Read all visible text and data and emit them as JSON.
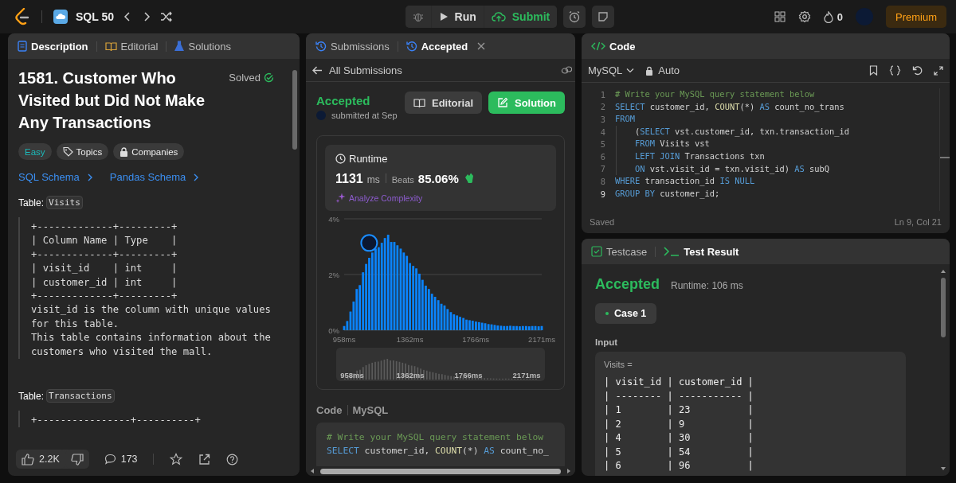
{
  "topbar": {
    "list_title": "SQL 50",
    "run": "Run",
    "submit": "Submit",
    "streak": "0",
    "premium": "Premium"
  },
  "description_panel": {
    "tabs": [
      {
        "label": "Description",
        "kind": "description",
        "selected": true
      },
      {
        "label": "Editorial",
        "kind": "editorial",
        "selected": false
      },
      {
        "label": "Solutions",
        "kind": "solutions",
        "selected": false
      }
    ],
    "title": "1581. Customer Who Visited but Did Not Make Any Transactions",
    "status": "Solved",
    "tags": [
      {
        "label": "Easy",
        "kind": "difficulty"
      },
      {
        "label": "Topics",
        "kind": "topics"
      },
      {
        "label": "Companies",
        "kind": "companies"
      }
    ],
    "links": [
      "SQL Schema",
      "Pandas Schema"
    ],
    "tables": [
      {
        "label": "Table:",
        "name": "Visits",
        "schema": "+-------------+---------+\n| Column Name | Type    |\n+-------------+---------+\n| visit_id    | int     |\n| customer_id | int     |\n+-------------+---------+\nvisit_id is the column with unique values\nfor this table.\nThis table contains information about the\ncustomers who visited the mall."
      },
      {
        "label": "Table:",
        "name": "Transactions",
        "schema": "+----------------+----------+"
      }
    ],
    "footer": {
      "likes": "2.2K",
      "comments": "173"
    }
  },
  "submission_panel": {
    "tabs": [
      {
        "label": "Submissions",
        "selected": false
      },
      {
        "label": "Accepted",
        "selected": true
      }
    ],
    "back_link": "All Submissions",
    "status": "Accepted",
    "submitted": "submitted at Sep",
    "buttons": [
      {
        "label": "Editorial",
        "kind": "editorial"
      },
      {
        "label": "Solution",
        "kind": "solution"
      }
    ],
    "runtime": {
      "title": "Runtime",
      "value": "1131",
      "unit": "ms",
      "beats_label": "Beats",
      "beats": "85.06%",
      "analyze": "Analyze Complexity"
    },
    "chart_data": {
      "type": "bar",
      "x": [
        958,
        977,
        997,
        1016,
        1035,
        1054,
        1074,
        1093,
        1112,
        1131,
        1151,
        1170,
        1189,
        1208,
        1228,
        1247,
        1266,
        1285,
        1305,
        1324,
        1343,
        1362,
        1382,
        1401,
        1420,
        1439,
        1459,
        1478,
        1497,
        1516,
        1536,
        1555,
        1574,
        1593,
        1613,
        1632,
        1651,
        1670,
        1690,
        1709,
        1728,
        1747,
        1767,
        1786,
        1805,
        1824,
        1844,
        1863,
        1882,
        1901,
        1921,
        1940,
        1959,
        1978,
        1998,
        2017,
        2036,
        2055,
        2075,
        2094,
        2113,
        2132,
        2152,
        2171
      ],
      "values": [
        0.15,
        0.33,
        0.67,
        1.03,
        1.48,
        1.62,
        2.08,
        2.38,
        2.6,
        2.79,
        2.93,
        2.98,
        3.14,
        3.31,
        3.43,
        3.17,
        3.17,
        3.05,
        2.93,
        2.79,
        2.67,
        2.41,
        2.31,
        2.22,
        2.03,
        1.81,
        1.6,
        1.48,
        1.31,
        1.2,
        1.08,
        0.95,
        0.89,
        0.76,
        0.65,
        0.57,
        0.53,
        0.48,
        0.44,
        0.38,
        0.36,
        0.34,
        0.31,
        0.29,
        0.27,
        0.25,
        0.22,
        0.21,
        0.19,
        0.17,
        0.16,
        0.15,
        0.15,
        0.16,
        0.15,
        0.15,
        0.14,
        0.15,
        0.15,
        0.14,
        0.15,
        0.15,
        0.14,
        0.15
      ],
      "xlim": [
        958,
        2171
      ],
      "ylim": [
        0,
        4
      ],
      "xticks": [
        {
          "value": 958,
          "label": "958ms"
        },
        {
          "value": 1362,
          "label": "1362ms"
        },
        {
          "value": 1766,
          "label": "1766ms"
        },
        {
          "value": 2171,
          "label": "2171ms"
        }
      ],
      "yticks": [
        {
          "value": 0,
          "label": "0%"
        },
        {
          "value": 2,
          "label": "2%"
        },
        {
          "value": 4,
          "label": "4%"
        }
      ]
    },
    "overview_labels": [
      "958ms",
      "1362ms",
      "1766ms",
      "2171ms"
    ],
    "code_title": "Code",
    "code_language": "MySQL",
    "code_preview": [
      [
        {
          "kind": "comment",
          "text": "# Write your MySQL query statement below"
        }
      ],
      [
        {
          "kind": "keyword",
          "text": "SELECT"
        },
        {
          "kind": "plain",
          "text": " customer_id, "
        },
        {
          "kind": "function",
          "text": "COUNT"
        },
        {
          "kind": "plain",
          "text": "(*) "
        },
        {
          "kind": "keyword",
          "text": "AS"
        },
        {
          "kind": "plain",
          "text": " count_no_"
        }
      ]
    ]
  },
  "editor": {
    "title": "Code",
    "language": "MySQL",
    "mode": "Auto",
    "lines": [
      {
        "number": "1",
        "current": false,
        "tokens": [
          {
            "kind": "comment",
            "text": "# Write your MySQL query statement below"
          }
        ]
      },
      {
        "number": "2",
        "current": false,
        "tokens": [
          {
            "kind": "keyword",
            "text": "SELECT"
          },
          {
            "kind": "plain",
            "text": " customer_id, "
          },
          {
            "kind": "function",
            "text": "COUNT"
          },
          {
            "kind": "plain",
            "text": "(*) "
          },
          {
            "kind": "keyword",
            "text": "AS"
          },
          {
            "kind": "plain",
            "text": " count_no_trans"
          }
        ]
      },
      {
        "number": "3",
        "current": false,
        "tokens": [
          {
            "kind": "keyword",
            "text": "FROM"
          }
        ]
      },
      {
        "number": "4",
        "current": false,
        "tokens": [
          {
            "kind": "plain",
            "text": "    ("
          },
          {
            "kind": "keyword",
            "text": "SELECT"
          },
          {
            "kind": "plain",
            "text": " vst.customer_id, txn.transaction_id"
          }
        ]
      },
      {
        "number": "5",
        "current": false,
        "tokens": [
          {
            "kind": "keyword",
            "text": "    FROM"
          },
          {
            "kind": "plain",
            "text": " Visits vst"
          }
        ]
      },
      {
        "number": "6",
        "current": false,
        "tokens": [
          {
            "kind": "keyword",
            "text": "    LEFT JOIN"
          },
          {
            "kind": "plain",
            "text": " Transactions txn"
          }
        ]
      },
      {
        "number": "7",
        "current": false,
        "tokens": [
          {
            "kind": "keyword",
            "text": "    ON"
          },
          {
            "kind": "plain",
            "text": " vst.visit_id = txn.visit_id) "
          },
          {
            "kind": "keyword",
            "text": "AS"
          },
          {
            "kind": "plain",
            "text": " subQ"
          }
        ]
      },
      {
        "number": "8",
        "current": false,
        "tokens": [
          {
            "kind": "keyword",
            "text": "WHERE"
          },
          {
            "kind": "plain",
            "text": " transaction_id "
          },
          {
            "kind": "keyword",
            "text": "IS NULL"
          }
        ]
      },
      {
        "number": "9",
        "current": true,
        "tokens": [
          {
            "kind": "keyword",
            "text": "GROUP BY"
          },
          {
            "kind": "plain",
            "text": " customer_id;"
          }
        ]
      }
    ],
    "saved": "Saved",
    "cursor": "Ln 9, Col 21"
  },
  "result_panel": {
    "tabs": [
      {
        "label": "Testcase",
        "kind": "testcase",
        "selected": false
      },
      {
        "label": "Test Result",
        "kind": "result",
        "selected": true
      }
    ],
    "status": "Accepted",
    "runtime": "Runtime: 106 ms",
    "cases": [
      {
        "label": "Case 1",
        "selected": true
      }
    ],
    "input_label": "Input",
    "variable": "Visits =",
    "table_lines": [
      "| visit_id | customer_id |",
      "| -------- | ----------- |",
      "| 1        | 23          |",
      "| 2        | 9           |",
      "| 4        | 30          |",
      "| 5        | 54          |",
      "| 6        | 96          |"
    ]
  }
}
